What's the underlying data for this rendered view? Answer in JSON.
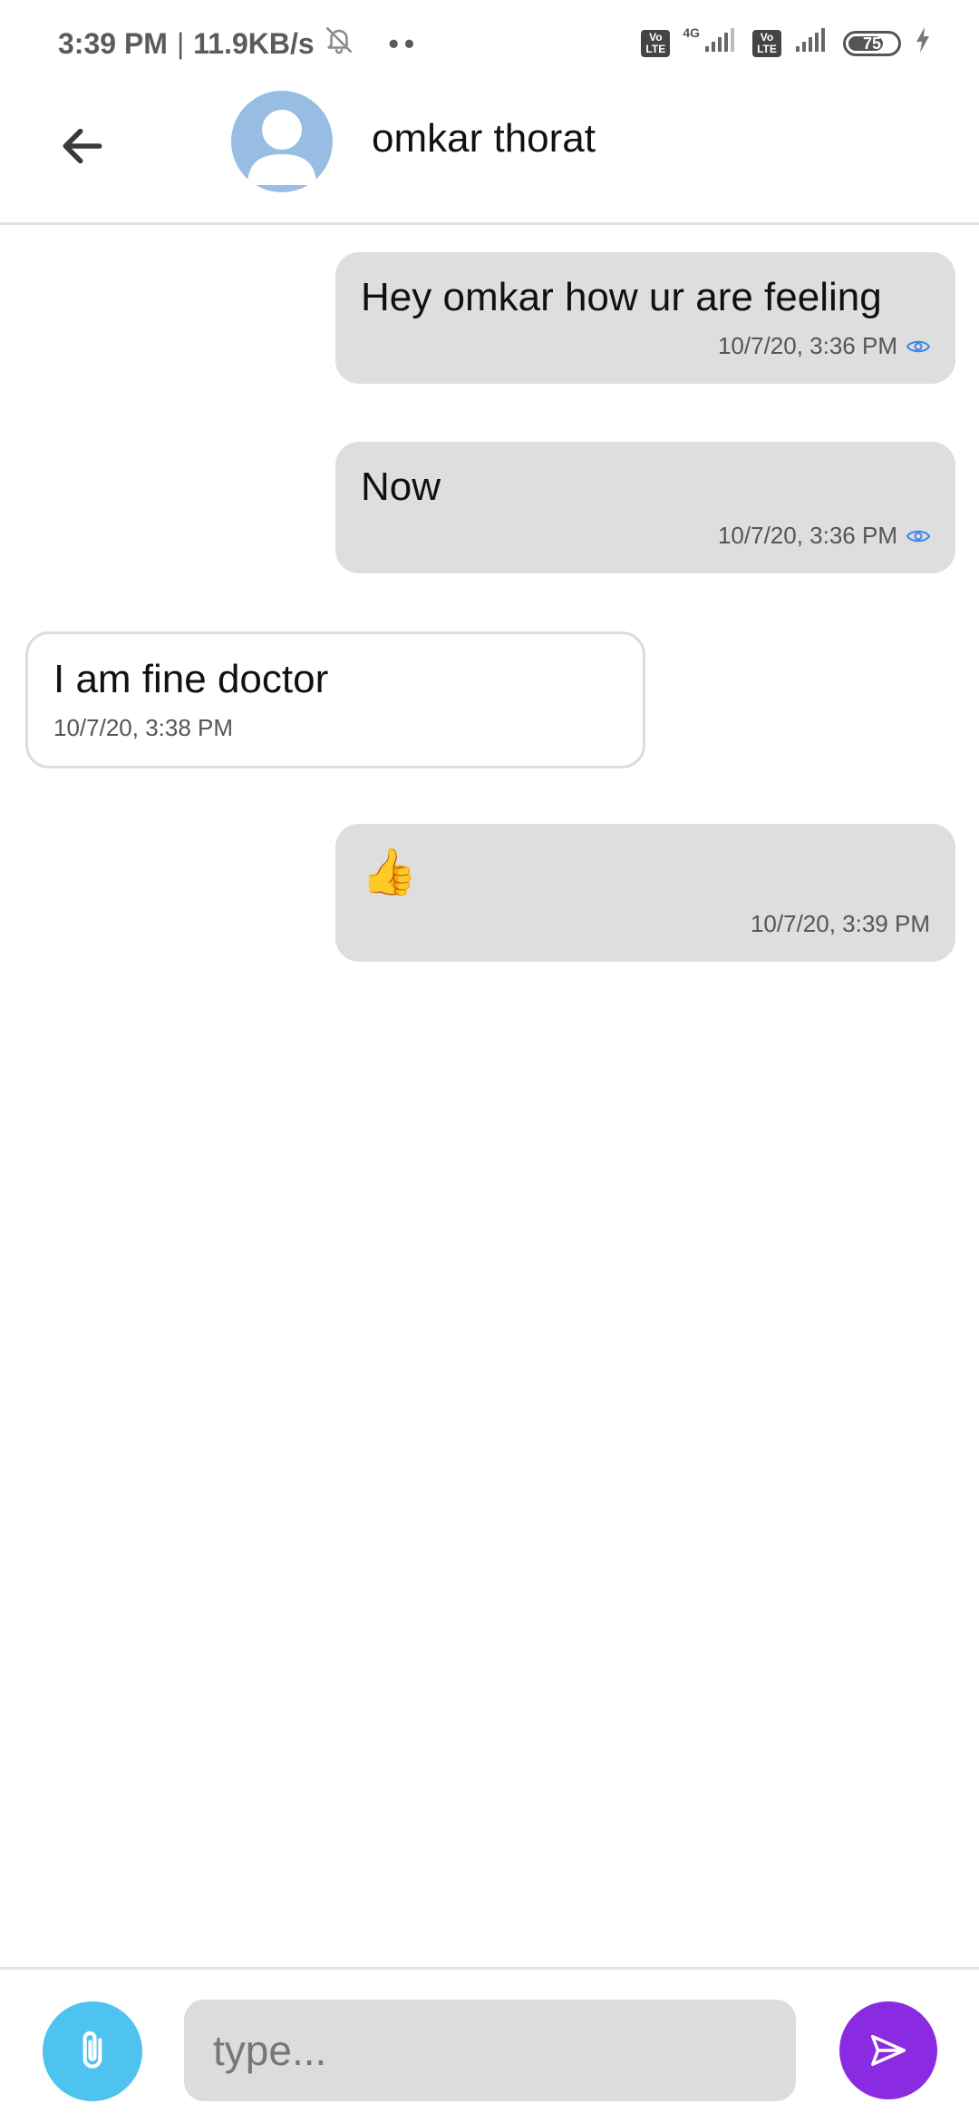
{
  "status_bar": {
    "time": "3:39 PM",
    "separator": "|",
    "speed": "11.9KB/s",
    "dots": "••",
    "volte_1": "Vo LTE",
    "network_type": "4G",
    "volte_2": "Vo LTE",
    "battery_level": "75"
  },
  "header": {
    "contact_name": "omkar thorat"
  },
  "messages": [
    {
      "direction": "outgoing",
      "text": "Hey omkar how ur are feeling",
      "timestamp": "10/7/20, 3:36 PM",
      "seen": true
    },
    {
      "direction": "outgoing",
      "text": "Now",
      "timestamp": "10/7/20, 3:36 PM",
      "seen": true
    },
    {
      "direction": "incoming",
      "text": "I am fine doctor",
      "timestamp": "10/7/20, 3:38 PM",
      "seen": false
    },
    {
      "direction": "outgoing",
      "text": "👍",
      "timestamp": "10/7/20, 3:39 PM",
      "seen": false
    }
  ],
  "composer": {
    "placeholder": "type...",
    "value": ""
  },
  "colors": {
    "avatar_bg": "#97bde2",
    "outgoing_bubble": "#dedede",
    "incoming_border": "#dcdcdc",
    "attach_button": "#4fc3f0",
    "send_button": "#8a2be2",
    "seen_icon": "#3a86e8"
  },
  "icons": {
    "back": "arrow-left-icon",
    "avatar": "person-icon",
    "attach": "paperclip-icon",
    "send": "paper-plane-icon",
    "seen": "eye-icon",
    "mute": "bell-off-icon",
    "signal": "signal-icon",
    "battery": "battery-icon",
    "charging": "bolt-icon"
  }
}
